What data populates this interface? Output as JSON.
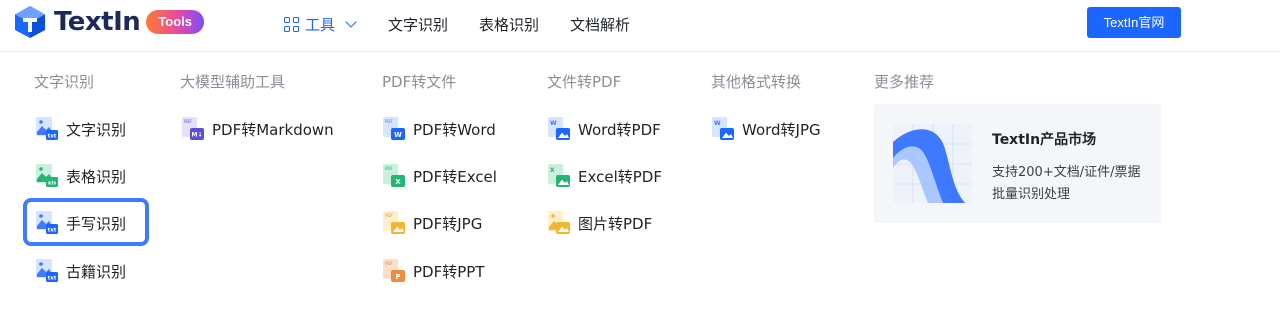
{
  "header": {
    "logo_text": "TextIn",
    "badge": "Tools",
    "nav": [
      {
        "label": "工具"
      },
      {
        "label": "文字识别"
      },
      {
        "label": "表格识别"
      },
      {
        "label": "文档解析"
      }
    ],
    "cta": "TextIn官网"
  },
  "menu": {
    "columns": [
      {
        "title": "文字识别",
        "items": [
          {
            "label": "文字识别",
            "icon": "image-text-icon"
          },
          {
            "label": "表格识别",
            "icon": "image-table-icon"
          },
          {
            "label": "手写识别",
            "icon": "image-text-icon"
          },
          {
            "label": "古籍识别",
            "icon": "image-text-icon"
          }
        ]
      },
      {
        "title": "大模型辅助工具",
        "items": [
          {
            "label": "PDF转Markdown",
            "icon": "markdown-file-icon"
          }
        ]
      },
      {
        "title": "PDF转文件",
        "items": [
          {
            "label": "PDF转Word",
            "icon": "pdf-word-icon"
          },
          {
            "label": "PDF转Excel",
            "icon": "pdf-excel-icon"
          },
          {
            "label": "PDF转JPG",
            "icon": "pdf-jpg-icon"
          },
          {
            "label": "PDF转PPT",
            "icon": "pdf-ppt-icon"
          }
        ]
      },
      {
        "title": "文件转PDF",
        "items": [
          {
            "label": "Word转PDF",
            "icon": "word-pdf-icon"
          },
          {
            "label": "Excel转PDF",
            "icon": "excel-pdf-icon"
          },
          {
            "label": "图片转PDF",
            "icon": "image-pdf-icon"
          }
        ]
      },
      {
        "title": "其他格式转换",
        "items": [
          {
            "label": "Word转JPG",
            "icon": "word-jpg-icon"
          }
        ]
      }
    ],
    "recommend": {
      "title": "更多推荐",
      "card_title": "TextIn产品市场",
      "card_line1": "支持200+文档/证件/票据",
      "card_line2": "批量识别处理"
    }
  },
  "colors": {
    "accent": "#1a66ff",
    "highlight": "#3f7bff",
    "excel": "#22b573",
    "ppt": "#f08a3c",
    "jpg": "#f2b632",
    "markdown": "#5b4fd6"
  }
}
